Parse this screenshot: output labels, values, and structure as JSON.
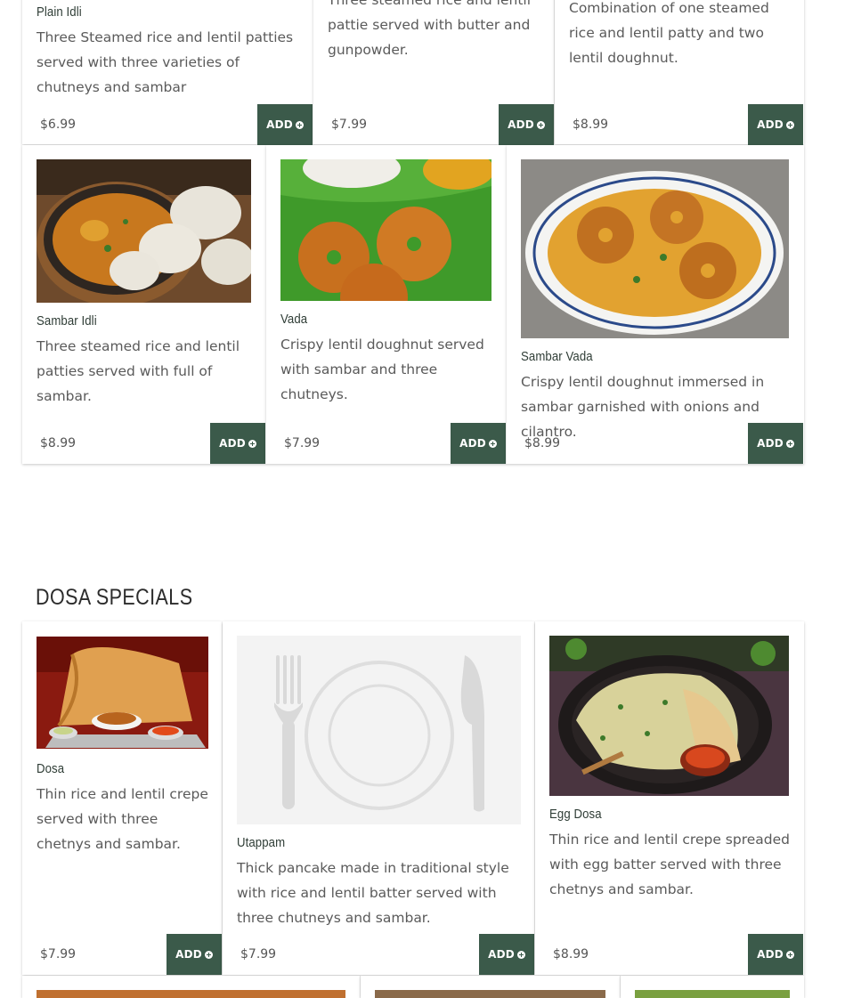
{
  "add_label": "ADD",
  "section_dosa": {
    "title": "DOSA SPECIALS"
  },
  "items": {
    "plain_idli": {
      "name": "Plain Idli",
      "desc": "Three Steamed rice and lentil patties served with three varieties of chutneys and sambar",
      "price": "$6.99"
    },
    "ghee_idli": {
      "desc": "Three steamed rice and lentil pattie served with butter and gunpowder.",
      "price": "$7.99"
    },
    "idli_vada": {
      "desc": "Combination of one steamed rice and lentil patty and two lentil doughnut.",
      "price": "$8.99"
    },
    "sambar_idli": {
      "name": "Sambar Idli",
      "desc": "Three steamed rice and lentil patties served with full of sambar.",
      "price": "$8.99"
    },
    "vada": {
      "name": "Vada",
      "desc": "Crispy lentil doughnut served with sambar and three chutneys.",
      "price": "$7.99"
    },
    "sambar_vada": {
      "name": "Sambar Vada",
      "desc": "Crispy lentil doughnut immersed in sambar garnished with onions and cilantro.",
      "price": "$8.99"
    },
    "dosa": {
      "name": "Dosa",
      "desc": "Thin rice and lentil crepe served with three chetnys and sambar.",
      "price": "$7.99"
    },
    "utappam": {
      "name": "Utappam",
      "desc": "Thick pancake made in traditional style with rice and lentil batter served with three chutneys and sambar.",
      "price": "$7.99"
    },
    "egg_dosa": {
      "name": "Egg Dosa",
      "desc": "Thin rice and lentil crepe spreaded with egg batter served with three chetnys and sambar.",
      "price": "$8.99"
    }
  },
  "colors": {
    "button_bg": "#3b5a4a",
    "heading": "#2f3d36"
  }
}
